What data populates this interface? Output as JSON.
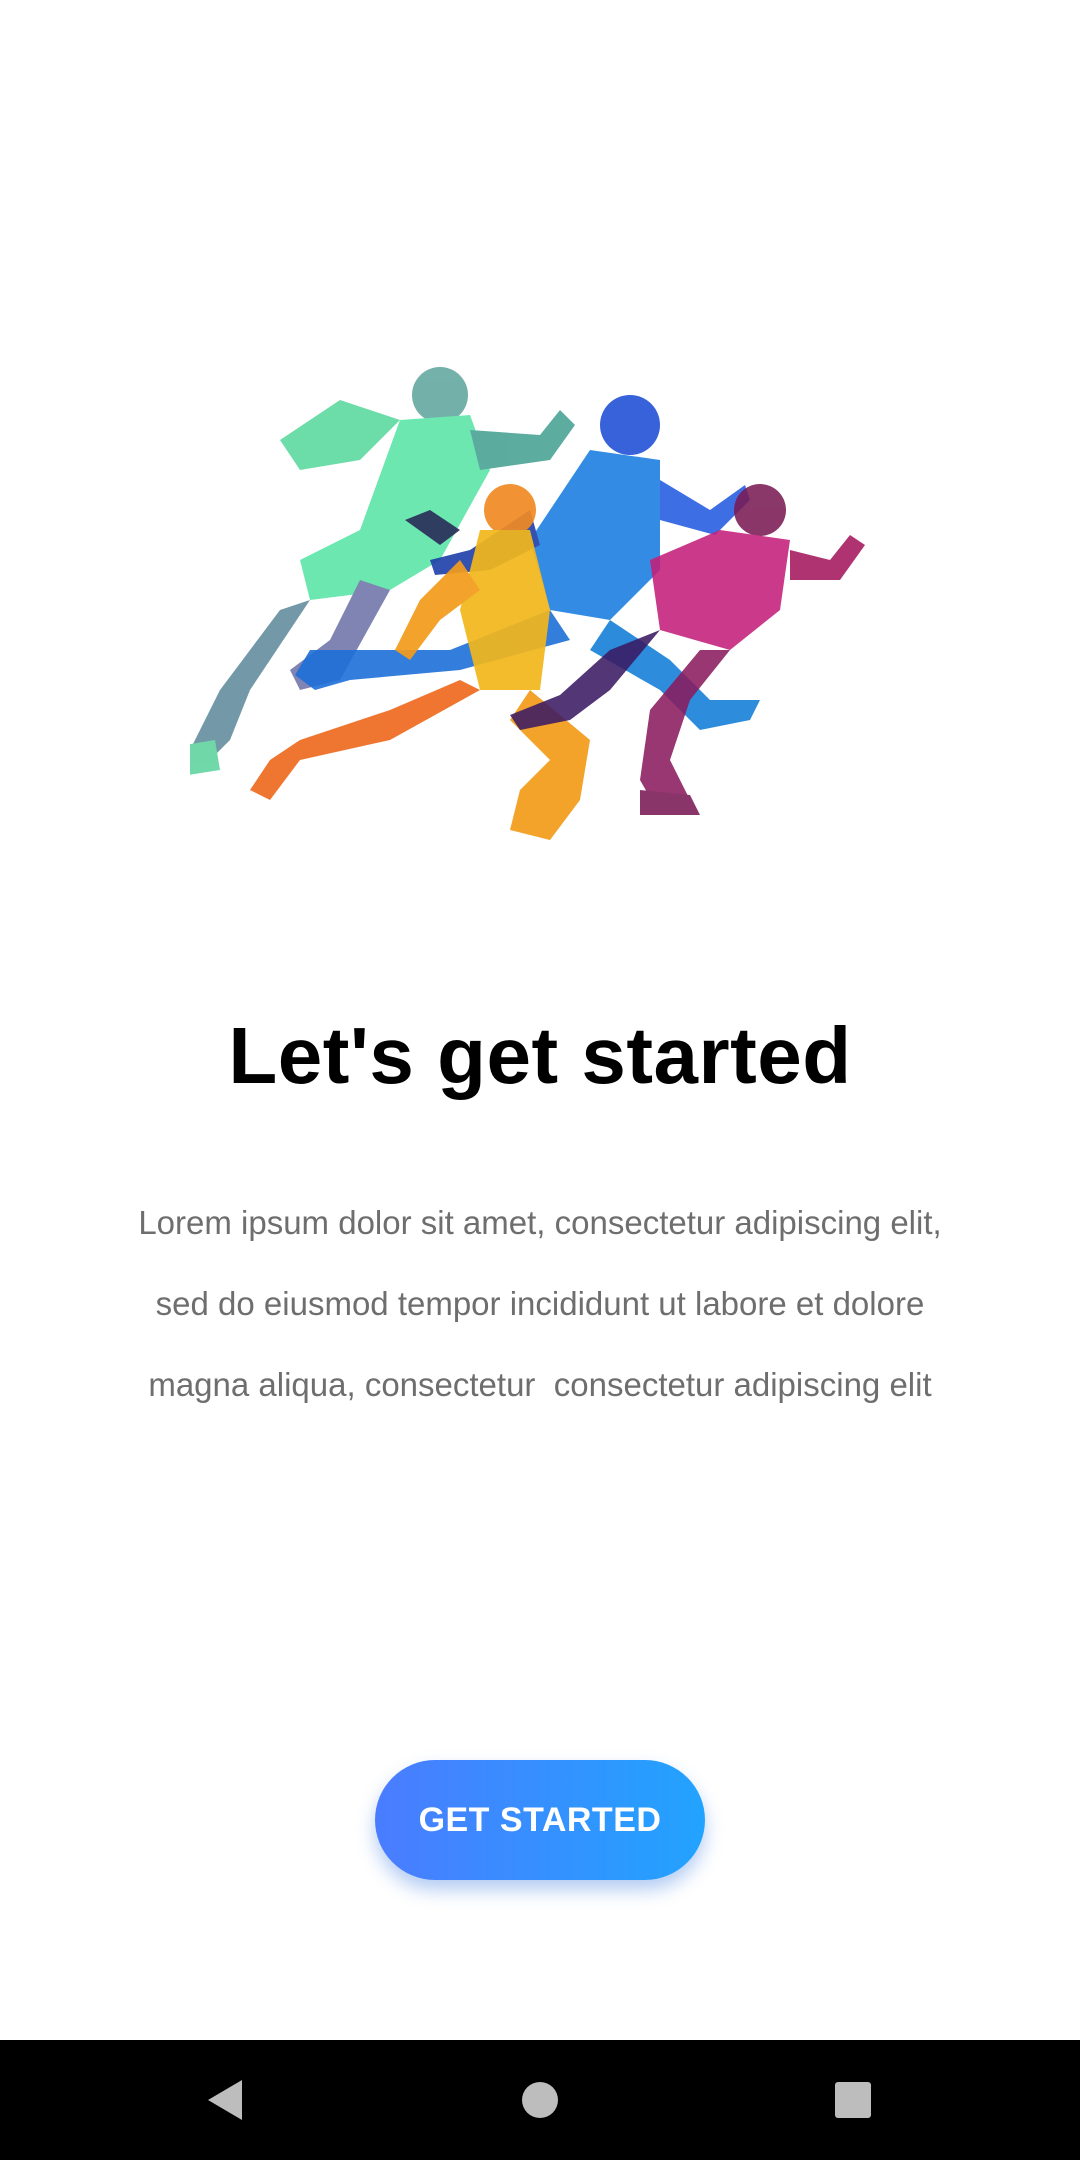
{
  "onboarding": {
    "title": "Let's get started",
    "description_lines": [
      "Lorem ipsum dolor sit amet, consectetur adipiscing elit,",
      "sed do eiusmod tempor incididunt ut labore et dolore",
      "magna aliqua, consectetur  consectetur adipiscing elit"
    ],
    "cta_label": "GET STARTED",
    "illustration": "runners-illustration"
  },
  "colors": {
    "background": "#ffffff",
    "title": "#000000",
    "body_text": "#6e6e6e",
    "cta_gradient_start": "#4a7cff",
    "cta_gradient_end": "#22a3ff",
    "nav_bar": "#000000",
    "nav_icons": "#bdbdbd"
  },
  "nav_bar": {
    "buttons": [
      "back-icon",
      "home-icon",
      "recents-icon"
    ]
  }
}
